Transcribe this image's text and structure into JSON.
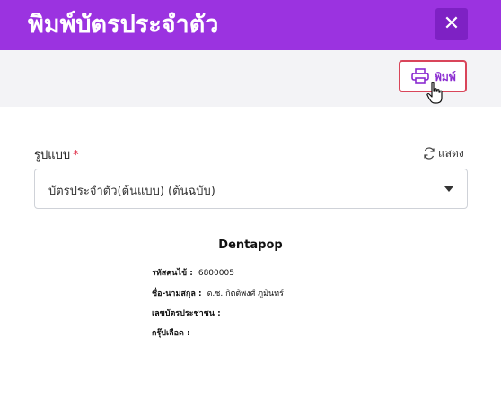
{
  "modal": {
    "title": "พิมพ์บัตรประจำตัว",
    "close_icon": "close-icon"
  },
  "toolbar": {
    "print_label": "พิมพ์",
    "print_icon": "printer-icon"
  },
  "form": {
    "format_label": "รูปแบบ",
    "required_mark": "*",
    "show_label": "แสดง",
    "selected_format": "บัตรประจำตัว(ต้นแบบ) (ต้นฉบับ)"
  },
  "card": {
    "title": "Dentapop",
    "rows": [
      {
        "label": "รหัสคนไข้ :",
        "value": "6800005"
      },
      {
        "label": "ชื่อ-นามสกุล :",
        "value": "ด.ช. กิตติพงศ์ ภูมินทร์"
      },
      {
        "label": "เลขบัตรประชาชน :",
        "value": ""
      },
      {
        "label": "กรุ๊ปเลือด :",
        "value": ""
      }
    ]
  },
  "colors": {
    "header": "#9b33e0",
    "accent": "#8a2bd0",
    "required": "#e0304a",
    "print_border": "#d9455a"
  }
}
